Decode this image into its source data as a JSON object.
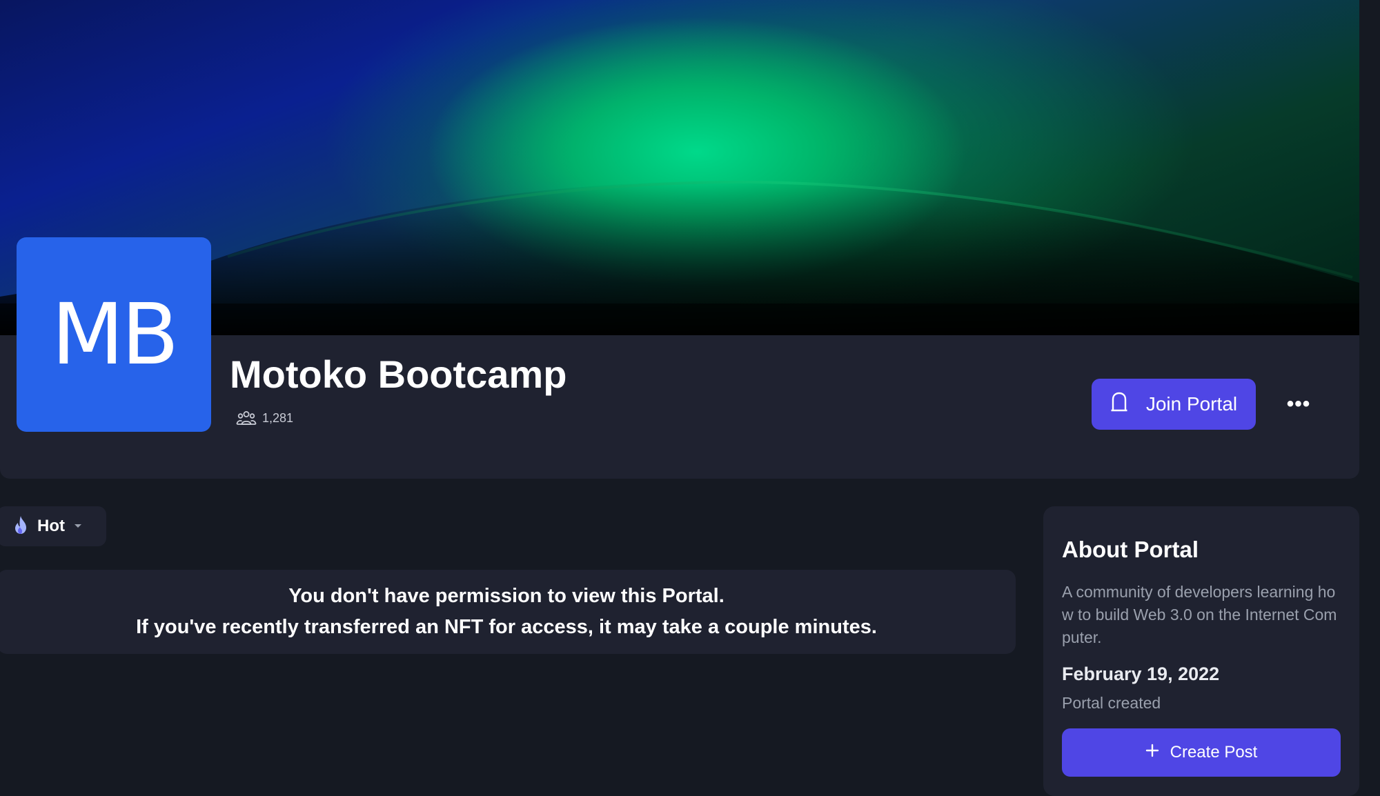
{
  "portal": {
    "avatar_initials": "MB",
    "title": "Motoko Bootcamp",
    "member_count": "1,281",
    "join_label": "Join Portal",
    "more_label": "•••"
  },
  "feed": {
    "sort_label": "Hot",
    "notice_line1": "You don't have permission to view this Portal.",
    "notice_line2": "If you've recently transferred an NFT for access, it may take a couple minutes."
  },
  "about": {
    "title": "About Portal",
    "description": "A community of developers learning how to build Web 3.0 on the Internet Computer.",
    "created_date": "February 19, 2022",
    "created_label": "Portal created",
    "create_post_label": "Create Post"
  },
  "colors": {
    "accent": "#4f46e5",
    "avatar": "#2763ea",
    "panel": "#1f2230",
    "background": "#151922"
  },
  "icons": {
    "members": "members-icon",
    "join": "bell-icon",
    "sort": "flame-icon",
    "dropdown": "caret-down-icon",
    "create": "plus-icon"
  }
}
